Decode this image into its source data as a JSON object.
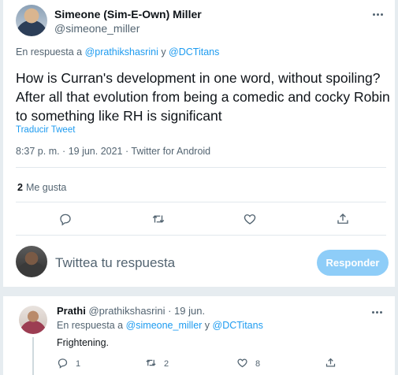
{
  "tweet": {
    "author_name": "Simeone (Sim-E-Own) Miller",
    "author_handle": "@simeone_miller",
    "reply_prefix": "En respuesta a ",
    "reply_mention_1": "@prathikshasrini",
    "reply_joiner": " y ",
    "reply_mention_2": "@DCTitans",
    "text": "How is Curran's development in one word, without spoiling? After all that evolution from being a comedic and cocky Robin to something like RH is significant",
    "translate_label": "Traducir Tweet",
    "meta": "8:37 p. m. · 19 jun. 2021 · Twitter for Android",
    "likes_count": "2",
    "likes_label": "Me gusta",
    "actions": [
      "reply-icon",
      "retweet-icon",
      "heart-icon",
      "share-icon"
    ]
  },
  "compose": {
    "placeholder": "Twittea tu respuesta",
    "button_label": "Responder"
  },
  "reply": {
    "author_name": "Prathi",
    "author_sub": " @prathikshasrini · 19 jun.",
    "reply_prefix": "En respuesta a ",
    "reply_mention_1": "@simeone_miller",
    "reply_joiner": " y ",
    "reply_mention_2": "@DCTitans",
    "text": "Frightening.",
    "reply_count": "1",
    "retweet_count": "2",
    "like_count": "8"
  },
  "colors": {
    "accent": "#1d9bf0",
    "button_disabled": "#8ecdf8",
    "muted_text": "#536471",
    "background": "#e6ecf0"
  }
}
